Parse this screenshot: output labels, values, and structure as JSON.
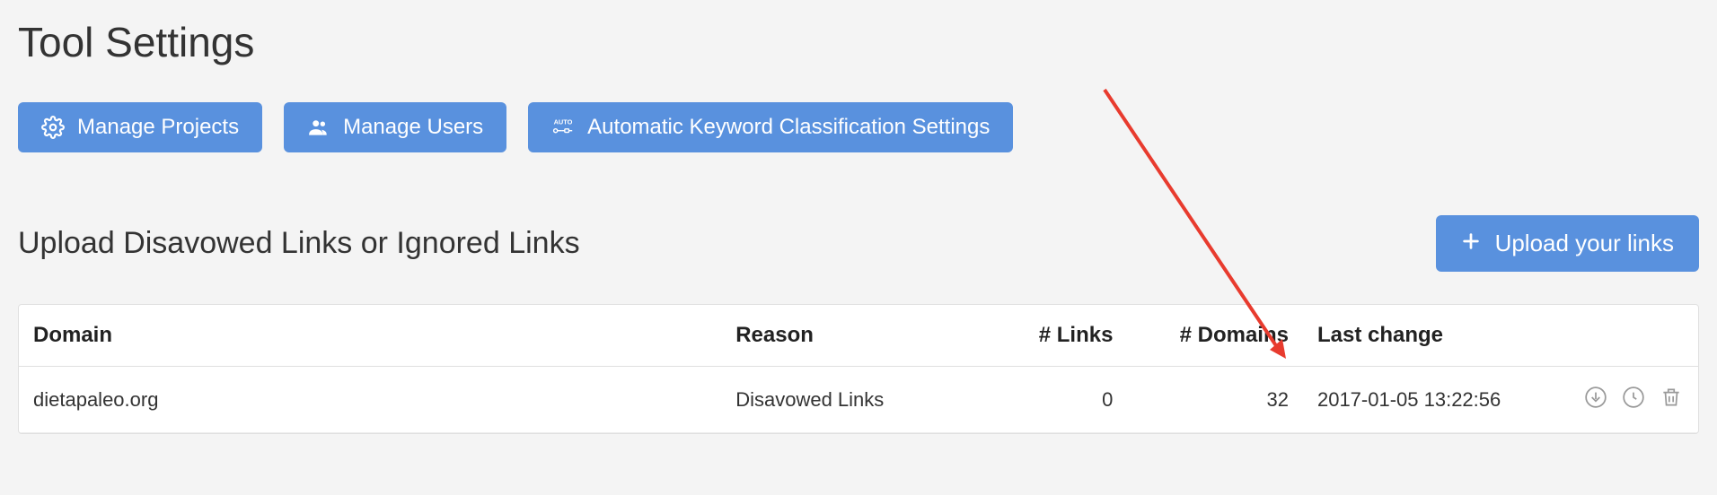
{
  "page_title": "Tool Settings",
  "toolbar": {
    "manage_projects": "Manage Projects",
    "manage_users": "Manage Users",
    "auto_classification": "Automatic Keyword Classification Settings"
  },
  "section": {
    "title": "Upload Disavowed Links or Ignored Links",
    "upload_button": "Upload your links"
  },
  "table": {
    "headers": {
      "domain": "Domain",
      "reason": "Reason",
      "links": "# Links",
      "domains": "# Domains",
      "last_change": "Last change"
    },
    "rows": [
      {
        "domain": "dietapaleo.org",
        "reason": "Disavowed Links",
        "links": "0",
        "domains": "32",
        "last_change": "2017-01-05 13:22:56"
      }
    ]
  }
}
